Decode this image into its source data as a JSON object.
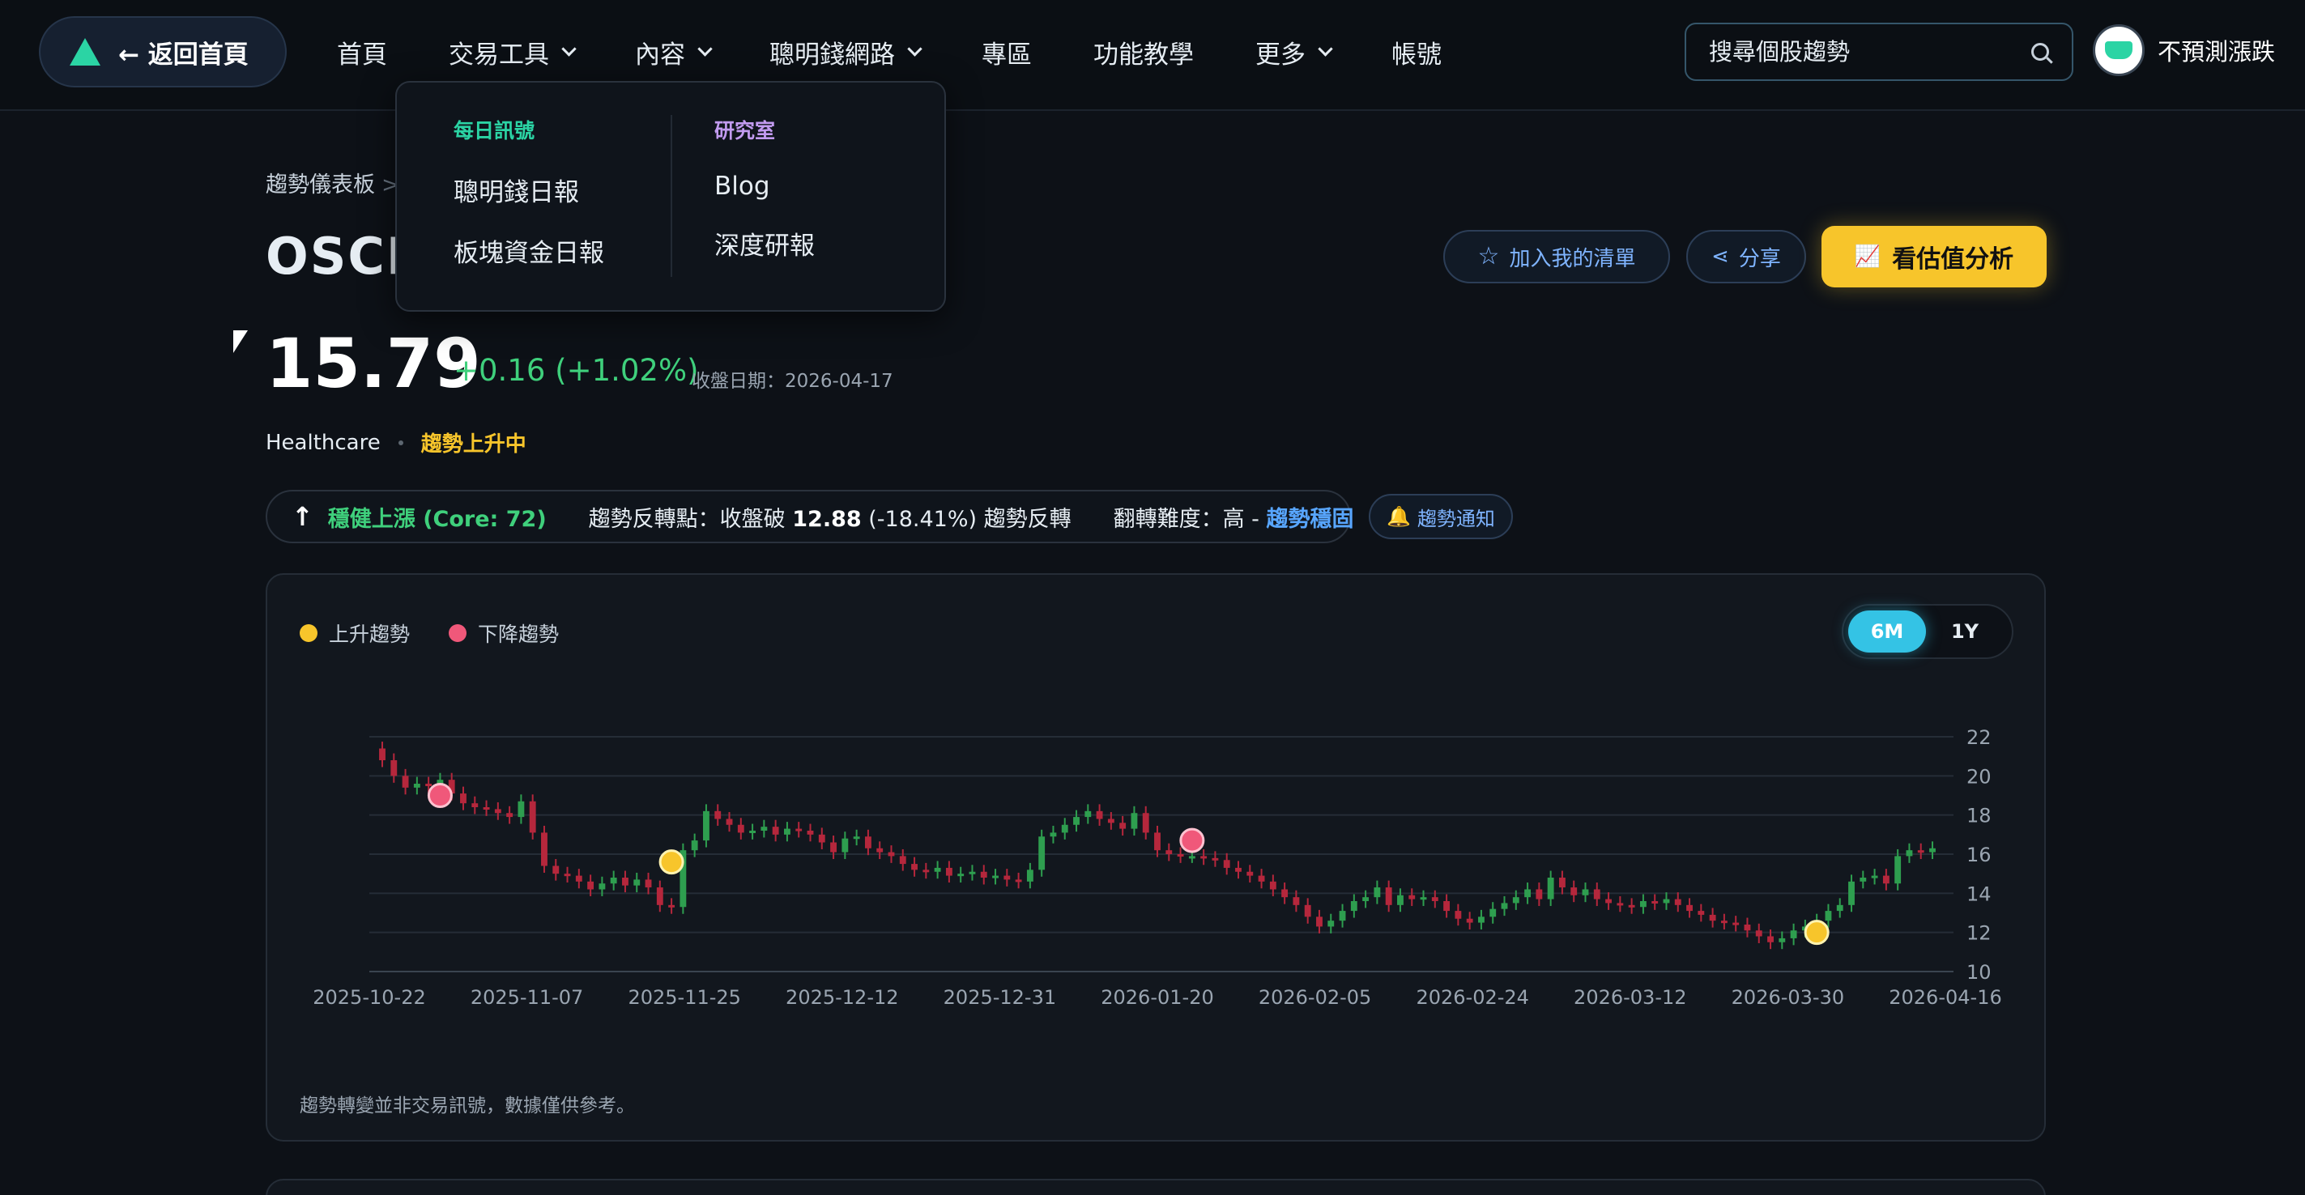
{
  "nav": {
    "home_label": "← 返回首頁",
    "items": [
      {
        "label": "首頁",
        "has_menu": false
      },
      {
        "label": "交易工具",
        "has_menu": true
      },
      {
        "label": "內容",
        "has_menu": true
      },
      {
        "label": "聰明錢網路",
        "has_menu": true
      },
      {
        "label": "專區",
        "has_menu": false
      },
      {
        "label": "功能教學",
        "has_menu": false
      },
      {
        "label": "更多",
        "has_menu": true
      },
      {
        "label": "帳號",
        "has_menu": false
      }
    ],
    "search_placeholder": "搜尋個股趨勢",
    "user_name": "不預測漲跌"
  },
  "dropdown": {
    "col1": {
      "heading": "每日訊號",
      "links": [
        "聰明錢日報",
        "板塊資金日報"
      ]
    },
    "col2": {
      "heading": "研究室",
      "links": [
        "Blog",
        "深度研報"
      ]
    }
  },
  "breadcrumb": {
    "root": "趨勢儀表板",
    "separator": ">"
  },
  "stock": {
    "title": "OSCR",
    "price": "15.79",
    "change": "+0.16 (+1.02%)",
    "close_date": "收盤日期：2026-04-17",
    "sector": "Healthcare",
    "trend_label": "趨勢上升中"
  },
  "actions": {
    "watchlist": "加入我的清單",
    "share": "分享",
    "valuation": "看估值分析"
  },
  "status": {
    "trend": "穩健上漲 (Core: 72)",
    "reversal_prefix": "趨勢反轉點：收盤破",
    "reversal_value": "12.88",
    "reversal_suffix": "(-18.41%) 趨勢反轉",
    "difficulty": "翻轉難度：高  -",
    "stability": "趨勢穩固",
    "notify": "趨勢通知"
  },
  "chart": {
    "legend": [
      {
        "label": "上升趨勢",
        "color": "#f7c52b"
      },
      {
        "label": "下降趨勢",
        "color": "#f0587a"
      }
    ],
    "ranges": [
      "6M",
      "1Y"
    ],
    "active_range": "6M",
    "disclaimer": "趨勢轉變並非交易訊號，數據僅供參考。",
    "up_color": "#2e9e4f",
    "down_color": "#b5273c"
  },
  "chart_data": {
    "type": "candlestick",
    "title": "",
    "ylim": [
      10,
      22
    ],
    "yticks": [
      10,
      12,
      14,
      16,
      18,
      20,
      22
    ],
    "x_tick_labels": [
      "2025-10-22",
      "2025-11-07",
      "2025-11-25",
      "2025-12-12",
      "2025-12-31",
      "2026-01-20",
      "2026-02-05",
      "2026-02-24",
      "2026-03-12",
      "2026-03-30",
      "2026-04-16"
    ],
    "closes": [
      20.8,
      20.0,
      19.4,
      19.6,
      19.5,
      19.8,
      19.1,
      18.6,
      18.4,
      18.3,
      18.1,
      17.9,
      18.7,
      17.1,
      15.4,
      15.0,
      14.9,
      14.6,
      14.2,
      14.5,
      14.8,
      14.4,
      14.7,
      14.3,
      13.4,
      13.3,
      16.2,
      16.7,
      18.2,
      17.8,
      17.5,
      17.1,
      17.2,
      17.4,
      17.0,
      17.3,
      17.2,
      17.0,
      16.6,
      16.1,
      16.8,
      16.9,
      16.3,
      16.1,
      15.9,
      15.5,
      15.2,
      15.1,
      15.3,
      14.9,
      15.0,
      15.1,
      14.8,
      14.9,
      14.7,
      14.6,
      15.2,
      16.9,
      17.1,
      17.5,
      17.9,
      18.2,
      17.8,
      17.6,
      17.3,
      18.1,
      17.1,
      16.2,
      16.0,
      15.9,
      15.9,
      15.8,
      15.7,
      15.3,
      15.1,
      14.9,
      14.6,
      14.2,
      13.8,
      13.4,
      12.8,
      12.3,
      12.6,
      13.1,
      13.6,
      13.8,
      14.3,
      13.4,
      13.9,
      13.7,
      13.8,
      13.6,
      13.1,
      12.7,
      12.5,
      12.8,
      13.2,
      13.5,
      13.8,
      14.2,
      13.7,
      14.8,
      14.3,
      13.9,
      14.2,
      13.7,
      13.5,
      13.4,
      13.3,
      13.6,
      13.5,
      13.7,
      13.4,
      13.1,
      12.9,
      12.6,
      12.5,
      12.4,
      12.1,
      11.8,
      11.5,
      11.7,
      12.1,
      12.3,
      12.6,
      13.1,
      13.4,
      14.6,
      14.8,
      14.9,
      14.5,
      15.9,
      16.2,
      16.1,
      16.3
    ],
    "markers": [
      {
        "type": "down",
        "index": 5,
        "y": 19.0
      },
      {
        "type": "up",
        "index": 25,
        "y": 15.6
      },
      {
        "type": "down",
        "index": 70,
        "y": 16.7
      },
      {
        "type": "up",
        "index": 124,
        "y": 12.0
      }
    ]
  }
}
